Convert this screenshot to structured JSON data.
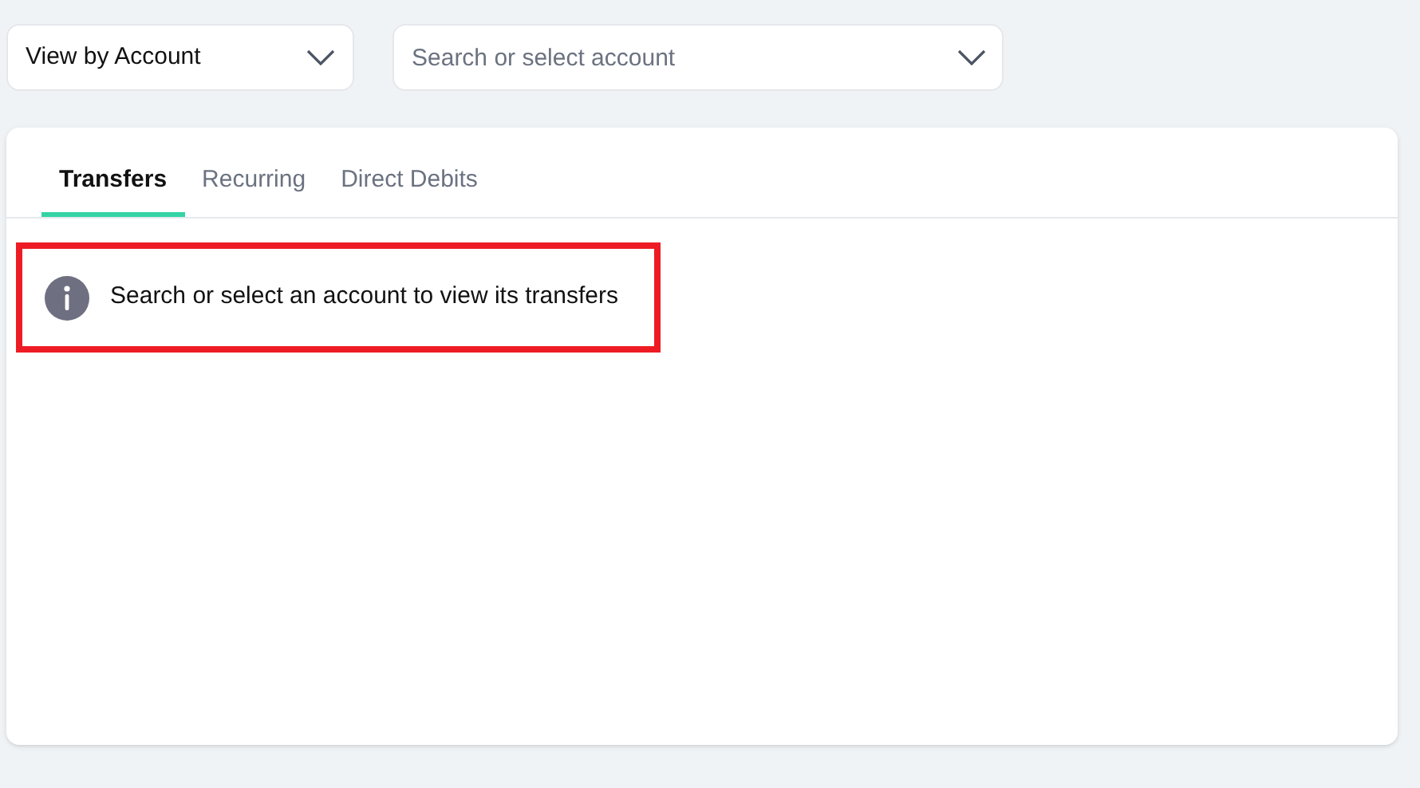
{
  "filters": {
    "view_select": {
      "value": "View by Account"
    },
    "account_select": {
      "placeholder": "Search or select account"
    }
  },
  "tabs": [
    {
      "label": "Transfers",
      "selected": true
    },
    {
      "label": "Recurring",
      "selected": false
    },
    {
      "label": "Direct Debits",
      "selected": false
    }
  ],
  "message": {
    "text": "Search or select an account to view its transfers",
    "highlighted": true
  }
}
